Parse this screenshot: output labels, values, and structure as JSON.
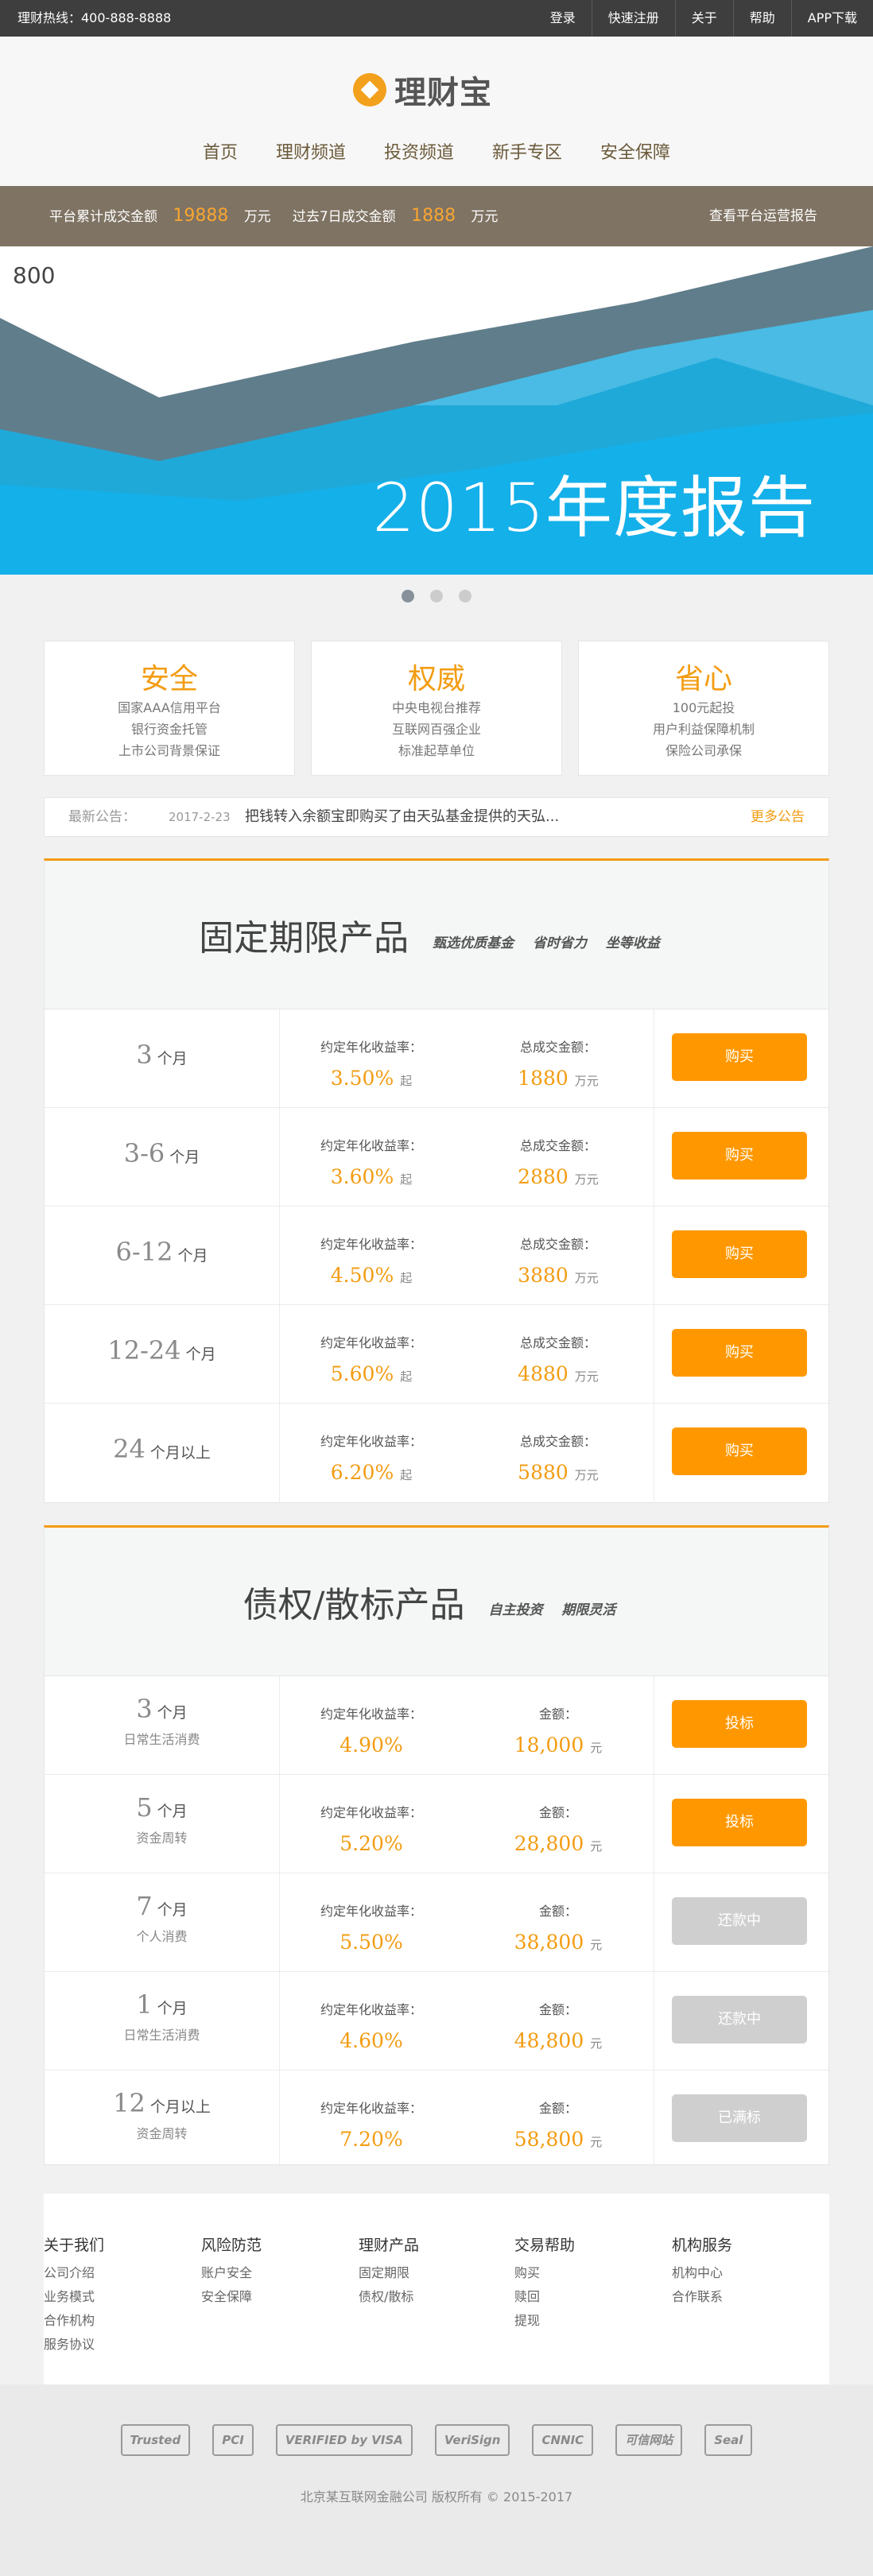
{
  "topbar": {
    "hotline": "理财热线：400-888-8888",
    "links": [
      "登录",
      "快速注册",
      "关于",
      "帮助",
      "APP下载"
    ]
  },
  "brand": {
    "name": "理财宝",
    "logo_icon": "gold-diamond-circle-icon",
    "accent": "#f39c12"
  },
  "nav": [
    "首页",
    "理财频道",
    "投资频道",
    "新手专区",
    "安全保障"
  ],
  "stats": {
    "total_label": "平台累计成交金额",
    "total_value": "19888",
    "unit1": "万元",
    "recent_label": "过去7日成交金额",
    "recent_value": "1888",
    "unit2": "万元",
    "report_link": "查看平台运营报告"
  },
  "banner": {
    "axis_label": "800",
    "title": "2015年度报告",
    "slides": 3,
    "active_slide": 1
  },
  "features": [
    {
      "title": "安全",
      "lines": [
        "国家AAA信用平台",
        "银行资金托管",
        "上市公司背景保证"
      ]
    },
    {
      "title": "权威",
      "lines": [
        "中央电视台推荐",
        "互联网百强企业",
        "标准起草单位"
      ]
    },
    {
      "title": "省心",
      "lines": [
        "100元起投",
        "用户利益保障机制",
        "保险公司承保"
      ]
    }
  ],
  "notice": {
    "label": "最新公告：",
    "date": "2017-2-23",
    "text": "把钱转入余额宝即购买了由天弘基金提供的天弘...",
    "more": "更多公告"
  },
  "fixed": {
    "title": "固定期限产品",
    "tags": [
      "甄选优质基金",
      "省时省力",
      "坐等收益"
    ],
    "rate_label": "约定年化收益率：",
    "amount_label": "总成交金额：",
    "rate_suffix": "起",
    "amount_unit": "万元",
    "rows": [
      {
        "term": "3",
        "unit": "个月",
        "rate": "3.50%",
        "amount": "1880",
        "button": "购买"
      },
      {
        "term": "3-6",
        "unit": "个月",
        "rate": "3.60%",
        "amount": "2880",
        "button": "购买"
      },
      {
        "term": "6-12",
        "unit": "个月",
        "rate": "4.50%",
        "amount": "3880",
        "button": "购买"
      },
      {
        "term": "12-24",
        "unit": "个月",
        "rate": "5.60%",
        "amount": "4880",
        "button": "购买"
      },
      {
        "term": "24",
        "unit": "个月以上",
        "rate": "6.20%",
        "amount": "5880",
        "button": "购买"
      }
    ]
  },
  "debt": {
    "title": "债权/散标产品",
    "tags": [
      "自主投资",
      "期限灵活"
    ],
    "rate_label": "约定年化收益率：",
    "amount_label": "金额：",
    "amount_unit": "元",
    "rows": [
      {
        "term": "3",
        "unit": "个月",
        "sub": "日常生活消费",
        "rate": "4.90%",
        "amount": "18,000",
        "button": "投标",
        "enabled": true
      },
      {
        "term": "5",
        "unit": "个月",
        "sub": "资金周转",
        "rate": "5.20%",
        "amount": "28,800",
        "button": "投标",
        "enabled": true
      },
      {
        "term": "7",
        "unit": "个月",
        "sub": "个人消费",
        "rate": "5.50%",
        "amount": "38,800",
        "button": "还款中",
        "enabled": false
      },
      {
        "term": "1",
        "unit": "个月",
        "sub": "日常生活消费",
        "rate": "4.60%",
        "amount": "48,800",
        "button": "还款中",
        "enabled": false
      },
      {
        "term": "12",
        "unit": "个月以上",
        "sub": "资金周转",
        "rate": "7.20%",
        "amount": "58,800",
        "button": "已满标",
        "enabled": false
      }
    ]
  },
  "footer": {
    "columns": [
      {
        "title": "关于我们",
        "links": [
          "公司介绍",
          "业务模式",
          "合作机构",
          "服务协议"
        ]
      },
      {
        "title": "风险防范",
        "links": [
          "账户安全",
          "安全保障"
        ]
      },
      {
        "title": "理财产品",
        "links": [
          "固定期限",
          "债权/散标"
        ]
      },
      {
        "title": "交易帮助",
        "links": [
          "购买",
          "赎回",
          "提现"
        ]
      },
      {
        "title": "机构服务",
        "links": [
          "机构中心",
          "合作联系"
        ]
      }
    ],
    "badges": [
      "Trusted",
      "PCI",
      "VERIFIED by VISA",
      "VeriSign",
      "CNNIC",
      "可信网站",
      "Seal"
    ],
    "copyright": "北京某互联网金融公司 版权所有 © 2015-2017"
  }
}
